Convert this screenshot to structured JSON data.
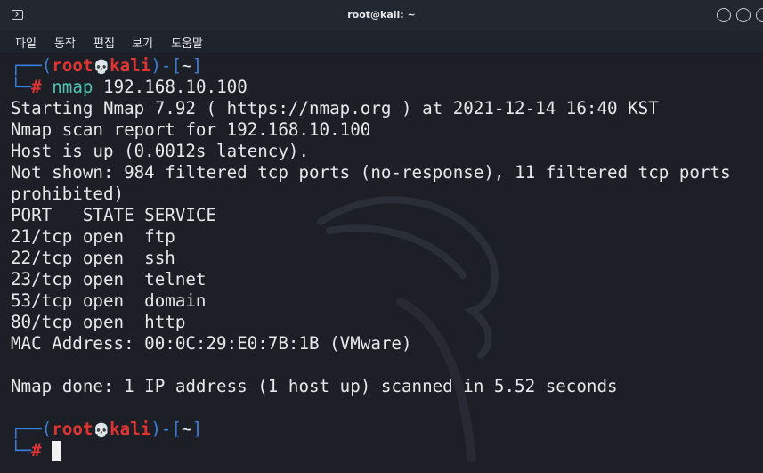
{
  "window": {
    "title": "root@kali: ~",
    "icon": "terminal-icon"
  },
  "menu": {
    "items": [
      "파일",
      "동작",
      "편집",
      "보기",
      "도움말"
    ]
  },
  "prompt1": {
    "open_paren": "┌──(",
    "user": "root",
    "skull": "💀",
    "host": "kali",
    "mid": ")-[",
    "dir": "~",
    "close": "]",
    "corner": "└─",
    "hash": "#",
    "command": "nmap",
    "argument": "192.168.10.100"
  },
  "output": [
    "Starting Nmap 7.92 ( https://nmap.org ) at 2021-12-14 16:40 KST",
    "Nmap scan report for 192.168.10.100",
    "Host is up (0.0012s latency).",
    "Not shown: 984 filtered tcp ports (no-response), 11 filtered tcp ports",
    "prohibited)",
    "PORT   STATE SERVICE",
    "21/tcp open  ftp",
    "22/tcp open  ssh",
    "23/tcp open  telnet",
    "53/tcp open  domain",
    "80/tcp open  http",
    "MAC Address: 00:0C:29:E0:7B:1B (VMware)",
    "",
    "Nmap done: 1 IP address (1 host up) scanned in 5.52 seconds"
  ],
  "prompt2": {
    "open_paren": "┌──(",
    "user": "root",
    "skull": "💀",
    "host": "kali",
    "mid": ")-[",
    "dir": "~",
    "close": "]",
    "corner": "└─",
    "hash": "#"
  }
}
